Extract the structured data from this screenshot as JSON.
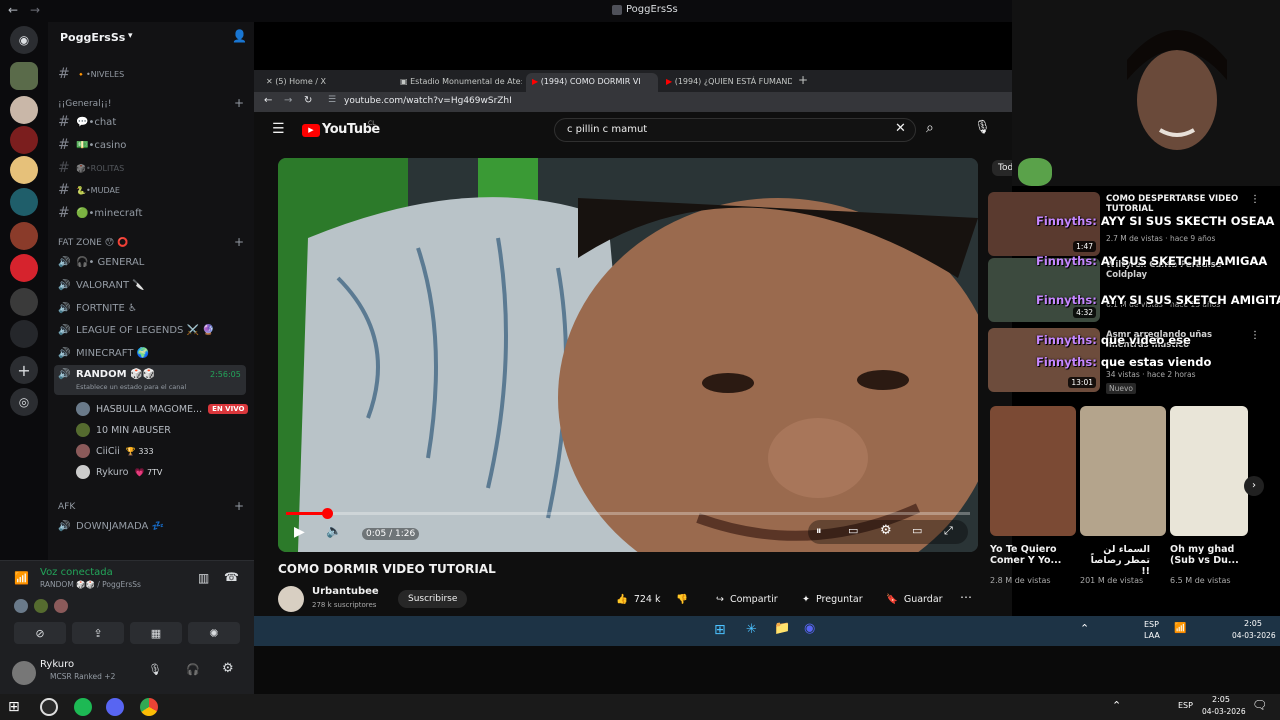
{
  "window": {
    "title": "PoggErsSs"
  },
  "server": {
    "name": "PoggErsSs"
  },
  "channels": [
    {
      "label": "🔸•NIVELES",
      "type": "text"
    },
    {
      "label": "💬•chat",
      "type": "text"
    },
    {
      "label": "💵•casino",
      "type": "text"
    },
    {
      "label": "🎲•ROLITAS",
      "type": "text"
    },
    {
      "label": "🐍•MUDAE",
      "type": "text"
    },
    {
      "label": "🟢•minecraft",
      "type": "text"
    }
  ],
  "categories": {
    "general": "¡¡General¡¡!",
    "fatzone": "FAT ZONE 😯 ⭕",
    "afk": "AFK"
  },
  "voice_channels": [
    {
      "label": "🎧• GENERAL"
    },
    {
      "label": "VALORANT 🔪"
    },
    {
      "label": "FORTNITE ♿"
    },
    {
      "label": "LEAGUE OF LEGENDS ⚔️ 🔮"
    },
    {
      "label": "MINECRAFT 🌍"
    }
  ],
  "random_channel": {
    "label": "RANDOM 🎲🎲",
    "timer": "2:56:05",
    "status": "Establece un estado para el canal"
  },
  "voice_users": [
    {
      "name": "HASBULLA MAGOME...",
      "badge": "EN VIVO"
    },
    {
      "name": "10 MIN ABUSER",
      "badge": ""
    },
    {
      "name": "CiiCii",
      "badge": "🏆 333"
    },
    {
      "name": "Rykuro",
      "badge": "💗 7TV"
    }
  ],
  "afk_channel": {
    "label": "DOWNJAMADA 💤"
  },
  "voice_panel": {
    "status": "Voz conectada",
    "location": "RANDOM 🎲🎲 / PoggErsSs"
  },
  "user": {
    "name": "Rykuro",
    "status": "MCSR Ranked +2"
  },
  "browser": {
    "tabs": [
      {
        "label": "(5) Home / X"
      },
      {
        "label": "Estadio Monumental de Ate: C"
      },
      {
        "label": "(1994) COMO DORMIR VI"
      },
      {
        "label": "(1994) ¿QUIEN ESTÁ FUMAND"
      }
    ],
    "url": "youtube.com/watch?v=Hg469wSrZhI"
  },
  "youtube": {
    "logo": "YouTube",
    "region": "CL",
    "search_query": "c pillin c mamut",
    "video_title": "COMO DORMIR VIDEO TUTORIAL",
    "time": "0:05 / 1:26",
    "progress": 0.06,
    "channel": "Urbantubee",
    "subscribers": "278 k suscriptores",
    "subscribe": "Suscribirse",
    "likes": "724 k",
    "share": "Compartir",
    "ask": "Preguntar",
    "save": "Guardar"
  },
  "related": [
    {
      "title": "COMO DESPERTARSE VIDEO TUTORIAL",
      "meta": "2.7 M de vistas · hace 9 años",
      "duration": "1:47"
    },
    {
      "title": "Wiltyrex Canta Paradise Coldplay",
      "meta": "6.1 M de vistas · hace 13 años",
      "duration": "4:32"
    },
    {
      "title": "Asmr arreglando uñas mientras mastico",
      "meta": "34 vistas · hace 2 horas",
      "duration": "13:01",
      "badge": "Nuevo"
    }
  ],
  "shorts": [
    {
      "title": "Yo Te Quiero Comer Y Yo...",
      "views": "2.8 M de vistas"
    },
    {
      "title": "السماء لن تمطر رصاصاً !!",
      "views": "201 M de vistas"
    },
    {
      "title": "Oh my ghad (Sub vs Du...",
      "views": "6.5 M de vistas"
    }
  ],
  "chat_overlay": [
    {
      "user": "Finnyths:",
      "msg": "AYY SI SUS SKECTH OSEAA"
    },
    {
      "user": "Finnyths:",
      "msg": "AY SUS SKETCHH AMIGAA"
    },
    {
      "user": "Finnyths:",
      "msg": "AYY SI SUS SKETCH AMIGITA"
    },
    {
      "user": "Finnyths:",
      "msg": "que video ese"
    },
    {
      "user": "Finnyths:",
      "msg": "que estas viendo"
    }
  ],
  "inner_tray": {
    "lang": "ESP",
    "sub": "LAA",
    "time": "2:05",
    "date": "04-03-2026"
  },
  "taskbar": {
    "lang": "ESP",
    "time": "2:05",
    "date": "04-03-2026"
  }
}
